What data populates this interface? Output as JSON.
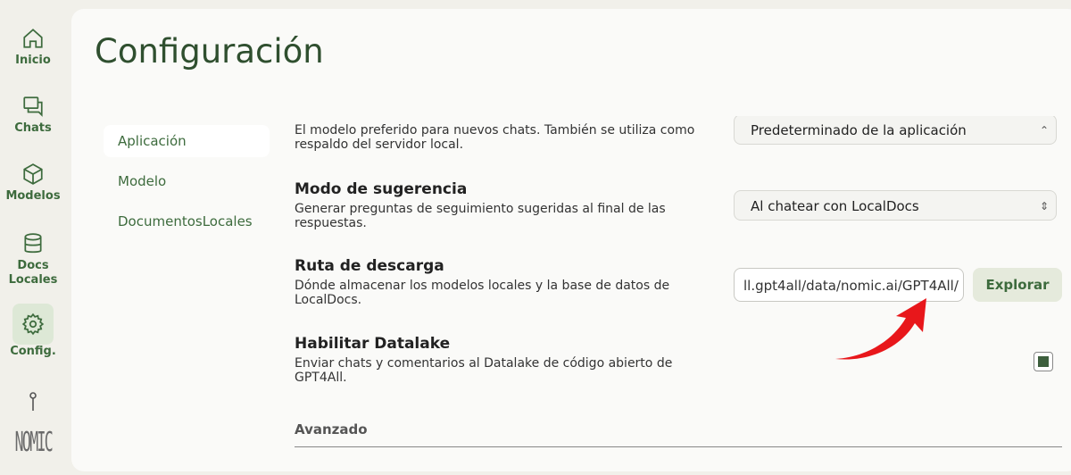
{
  "nav": {
    "items": [
      {
        "label": "Inicio",
        "icon": "home-icon"
      },
      {
        "label": "Chats",
        "icon": "chat-icon"
      },
      {
        "label": "Modelos",
        "icon": "cube-icon"
      },
      {
        "label": "Docs\nLocales",
        "icon": "database-icon"
      },
      {
        "label": "Config.",
        "icon": "gear-icon"
      }
    ],
    "brand": "NOMIC"
  },
  "page": {
    "title": "Configuración"
  },
  "tabs": [
    {
      "label": "Aplicación",
      "active": true
    },
    {
      "label": "Modelo",
      "active": false
    },
    {
      "label": "DocumentosLocales",
      "active": false
    }
  ],
  "settings": {
    "default_model": {
      "desc": "El modelo preferido para nuevos chats. También se utiliza como respaldo del servidor local.",
      "value": "Predeterminado de la aplicación"
    },
    "suggestion_mode": {
      "title": "Modo de sugerencia",
      "desc": "Generar preguntas de seguimiento sugeridas al final de las respuestas.",
      "value": "Al chatear con LocalDocs"
    },
    "download_path": {
      "title": "Ruta de descarga",
      "desc": "Dónde almacenar los modelos locales y la base de datos de LocalDocs.",
      "value": "ll.gpt4all/data/nomic.ai/GPT4All/",
      "browse_label": "Explorar"
    },
    "datalake": {
      "title": "Habilitar Datalake",
      "desc": "Enviar chats y comentarios al Datalake de código abierto de GPT4All.",
      "checked": true
    },
    "advanced_label": "Avanzado"
  },
  "colors": {
    "accent": "#3d6b3d",
    "arrow": "#e8171b"
  }
}
